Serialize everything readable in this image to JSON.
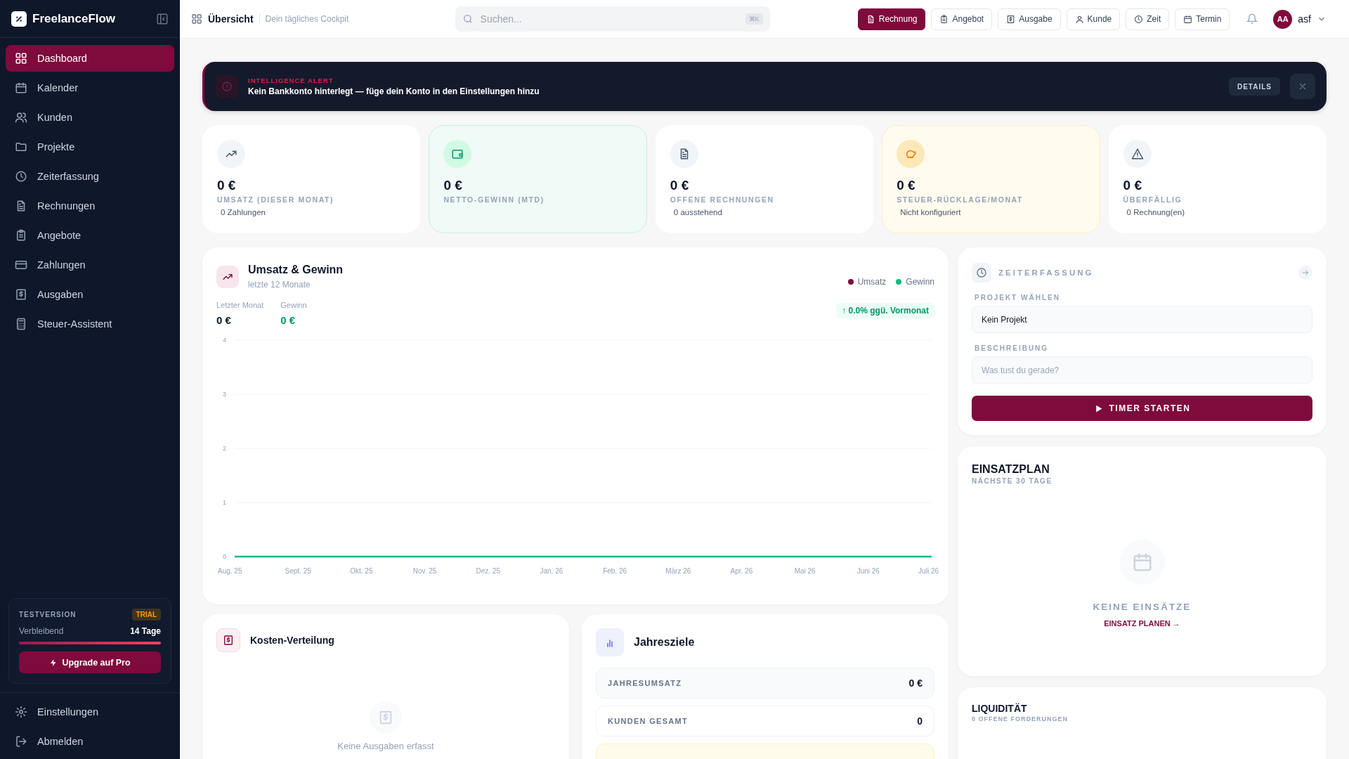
{
  "sidebar": {
    "brand": "FreelanceFlow",
    "items": [
      {
        "label": "Dashboard",
        "selected": true
      },
      {
        "label": "Kalender",
        "selected": false
      },
      {
        "label": "Kunden",
        "selected": false
      },
      {
        "label": "Projekte",
        "selected": false
      },
      {
        "label": "Zeiterfassung",
        "selected": false
      },
      {
        "label": "Rechnungen",
        "selected": false
      },
      {
        "label": "Angebote",
        "selected": false
      },
      {
        "label": "Zahlungen",
        "selected": false
      },
      {
        "label": "Ausgaben",
        "selected": false
      },
      {
        "label": "Steuer-Assistent",
        "selected": false
      }
    ],
    "trial": {
      "title": "TESTVERSION",
      "badge": "TRIAL",
      "label": "Verbleibend",
      "value": "14 Tage",
      "level": 1.0,
      "button": "Upgrade auf Pro"
    },
    "footer_items": [
      {
        "label": "Einstellungen"
      },
      {
        "label": "Abmelden"
      }
    ]
  },
  "header": {
    "title": "Übersicht",
    "subtitle": "Dein tägliches Cockpit",
    "search": {
      "placeholder": "Suchen...",
      "shortcut": "⌘K"
    },
    "actions": [
      {
        "label": "Rechnung",
        "kind": "primary"
      },
      {
        "label": "Angebot",
        "kind": "secondary"
      },
      {
        "label": "Ausgabe",
        "kind": "secondary"
      },
      {
        "label": "Kunde",
        "kind": "secondary"
      },
      {
        "label": "Zeit",
        "kind": "secondary"
      },
      {
        "label": "Termin",
        "kind": "secondary"
      }
    ],
    "user": {
      "initials": "AA",
      "name": "asf"
    }
  },
  "alert": {
    "title": "INTELLIGENCE ALERT",
    "message": "Kein Bankkonto hinterlegt — füge dein Konto in den Einstellungen hinzu",
    "button": "DETAILS"
  },
  "stats": [
    {
      "value": "0 €",
      "label": "UMSATZ (DIESER MONAT)",
      "note": "0 Zahlungen",
      "kind": "plain"
    },
    {
      "value": "0 €",
      "label": "NETTO-GEWINN (MTD)",
      "kind": "positive"
    },
    {
      "value": "0 €",
      "label": "OFFENE RECHNUNGEN",
      "note": "0 ausstehend",
      "kind": "plain"
    },
    {
      "value": "0 €",
      "label": "STEUER-RÜCKLAGE/MONAT",
      "note": "Nicht konfiguriert",
      "kind": "warning"
    },
    {
      "value": "0 €",
      "label": "ÜBERFÄLLIG",
      "note": "0 Rechnung(en)",
      "kind": "plain"
    }
  ],
  "revenue": {
    "title": "Umsatz & Gewinn",
    "subtitle": "letzte 12 Monate",
    "figures": [
      {
        "label": "Letzter Monat",
        "value": "0 €",
        "kind": "plain"
      },
      {
        "label": "Gewinn",
        "value": "0 €",
        "kind": "positive"
      }
    ],
    "trend": "↑ 0.0% ggü. Vormonat",
    "chart_data": {
      "type": "line",
      "categories": [
        "Aug. 25",
        "Sept. 25",
        "Okt. 25",
        "Nov. 25",
        "Dez. 25",
        "Jan. 26",
        "Feb. 26",
        "März 26",
        "Apr. 26",
        "Mai 26",
        "Juni 26",
        "Juli 26"
      ],
      "series": [
        {
          "name": "Umsatz",
          "color": "#7f0a3c",
          "values": [
            null,
            null,
            null,
            null,
            null,
            null,
            null,
            null,
            null,
            null,
            null,
            null
          ]
        },
        {
          "name": "Gewinn",
          "color": "#10b981",
          "values": [
            0,
            0,
            0,
            0,
            0,
            0,
            0,
            0,
            0,
            0,
            0,
            0
          ]
        }
      ],
      "ylim": [
        0,
        4
      ],
      "yticks": [
        0,
        1,
        2,
        3,
        4
      ],
      "grid": true
    }
  },
  "costs": {
    "title": "Kosten-Verteilung",
    "empty": "Keine Ausgaben erfasst"
  },
  "goals": {
    "title": "Jahresziele",
    "rows": [
      {
        "label": "JAHRESUMSATZ",
        "value": "0 €"
      },
      {
        "label": "KUNDEN GESAMT",
        "value": "0"
      }
    ]
  },
  "timer": {
    "title": "ZEITERFASSUNG",
    "project_label": "PROJEKT WÄHLEN",
    "project_value": "Kein Projekt",
    "description_label": "BESCHREIBUNG",
    "description_placeholder": "Was tust du gerade?",
    "button": "TIMER STARTEN"
  },
  "schedule": {
    "title": "EINSATZPLAN",
    "subtitle": "NÄCHSTE 30 TAGE",
    "empty": "KEINE EINSÄTZE",
    "link": "EINSATZ PLANEN →"
  },
  "liquidity": {
    "title": "LIQUIDITÄT",
    "subtitle": "0 OFFENE FORDERUNGEN"
  }
}
